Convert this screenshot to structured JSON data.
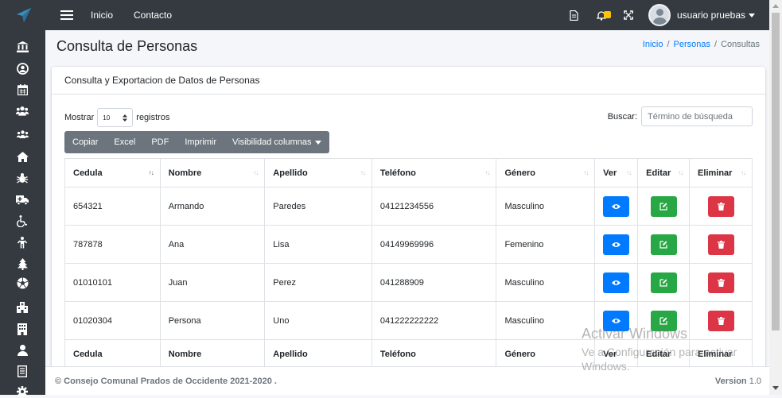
{
  "topbar": {
    "nav": [
      {
        "label": "Inicio"
      },
      {
        "label": "Contacto"
      }
    ],
    "user_name": "usuario pruebas"
  },
  "page": {
    "title": "Consulta de Personas",
    "breadcrumb": {
      "home": "Inicio",
      "section": "Personas",
      "current": "Consultas",
      "separator": "/"
    }
  },
  "card": {
    "title": "Consulta y Exportacion de Datos de Personas",
    "length_prefix": "Mostrar",
    "length_value": "10",
    "length_suffix": "registros",
    "search_label": "Buscar:",
    "search_placeholder": "Término de búsqueda",
    "buttons": [
      "Copiar",
      "Excel",
      "PDF",
      "Imprimir",
      "Visibilidad columnas"
    ]
  },
  "table": {
    "columns": [
      "Cedula",
      "Nombre",
      "Apellido",
      "Teléfono",
      "Género",
      "Ver",
      "Editar",
      "Eliminar"
    ],
    "rows": [
      {
        "cedula": "654321",
        "nombre": "Armando",
        "apellido": "Paredes",
        "telefono": "04121234556",
        "genero": "Masculino"
      },
      {
        "cedula": "787878",
        "nombre": "Ana",
        "apellido": "Lisa",
        "telefono": "04149969996",
        "genero": "Femenino"
      },
      {
        "cedula": "01010101",
        "nombre": "Juan",
        "apellido": "Perez",
        "telefono": "041288909",
        "genero": "Masculino"
      },
      {
        "cedula": "01020304",
        "nombre": "Persona",
        "apellido": "Uno",
        "telefono": "041222222222",
        "genero": "Masculino"
      }
    ]
  },
  "footer": {
    "copyright": "© Consejo Comunal Prados de Occidente 2021-2020 .",
    "version_label": "Version",
    "version_value": "1.0"
  },
  "watermark": {
    "line1": "Activar Windows",
    "line2": "Ve a Configuración para activar",
    "line3": "Windows."
  },
  "colors": {
    "navbar": "#343a40",
    "ver_button": "#007bff",
    "editar_button": "#28a745",
    "eliminar_button": "#dc3545",
    "export_buttons": "#6c757d",
    "link": "#007bff",
    "notification_badge": "#ffc107"
  },
  "icons": {
    "brand": "paper-plane-icon",
    "topbar": [
      "file-icon",
      "bell-icon",
      "expand-icon"
    ],
    "sidebar": [
      "bank-icon",
      "user-circle-icon",
      "calendar-icon",
      "users-icon",
      "users-small-icon",
      "home-icon",
      "bug-icon",
      "ambulance-icon",
      "wheelchair-icon",
      "child-icon",
      "tree-icon",
      "football-icon",
      "hospital-icon",
      "building-icon",
      "user-icon",
      "list-icon",
      "gear-icon"
    ]
  }
}
